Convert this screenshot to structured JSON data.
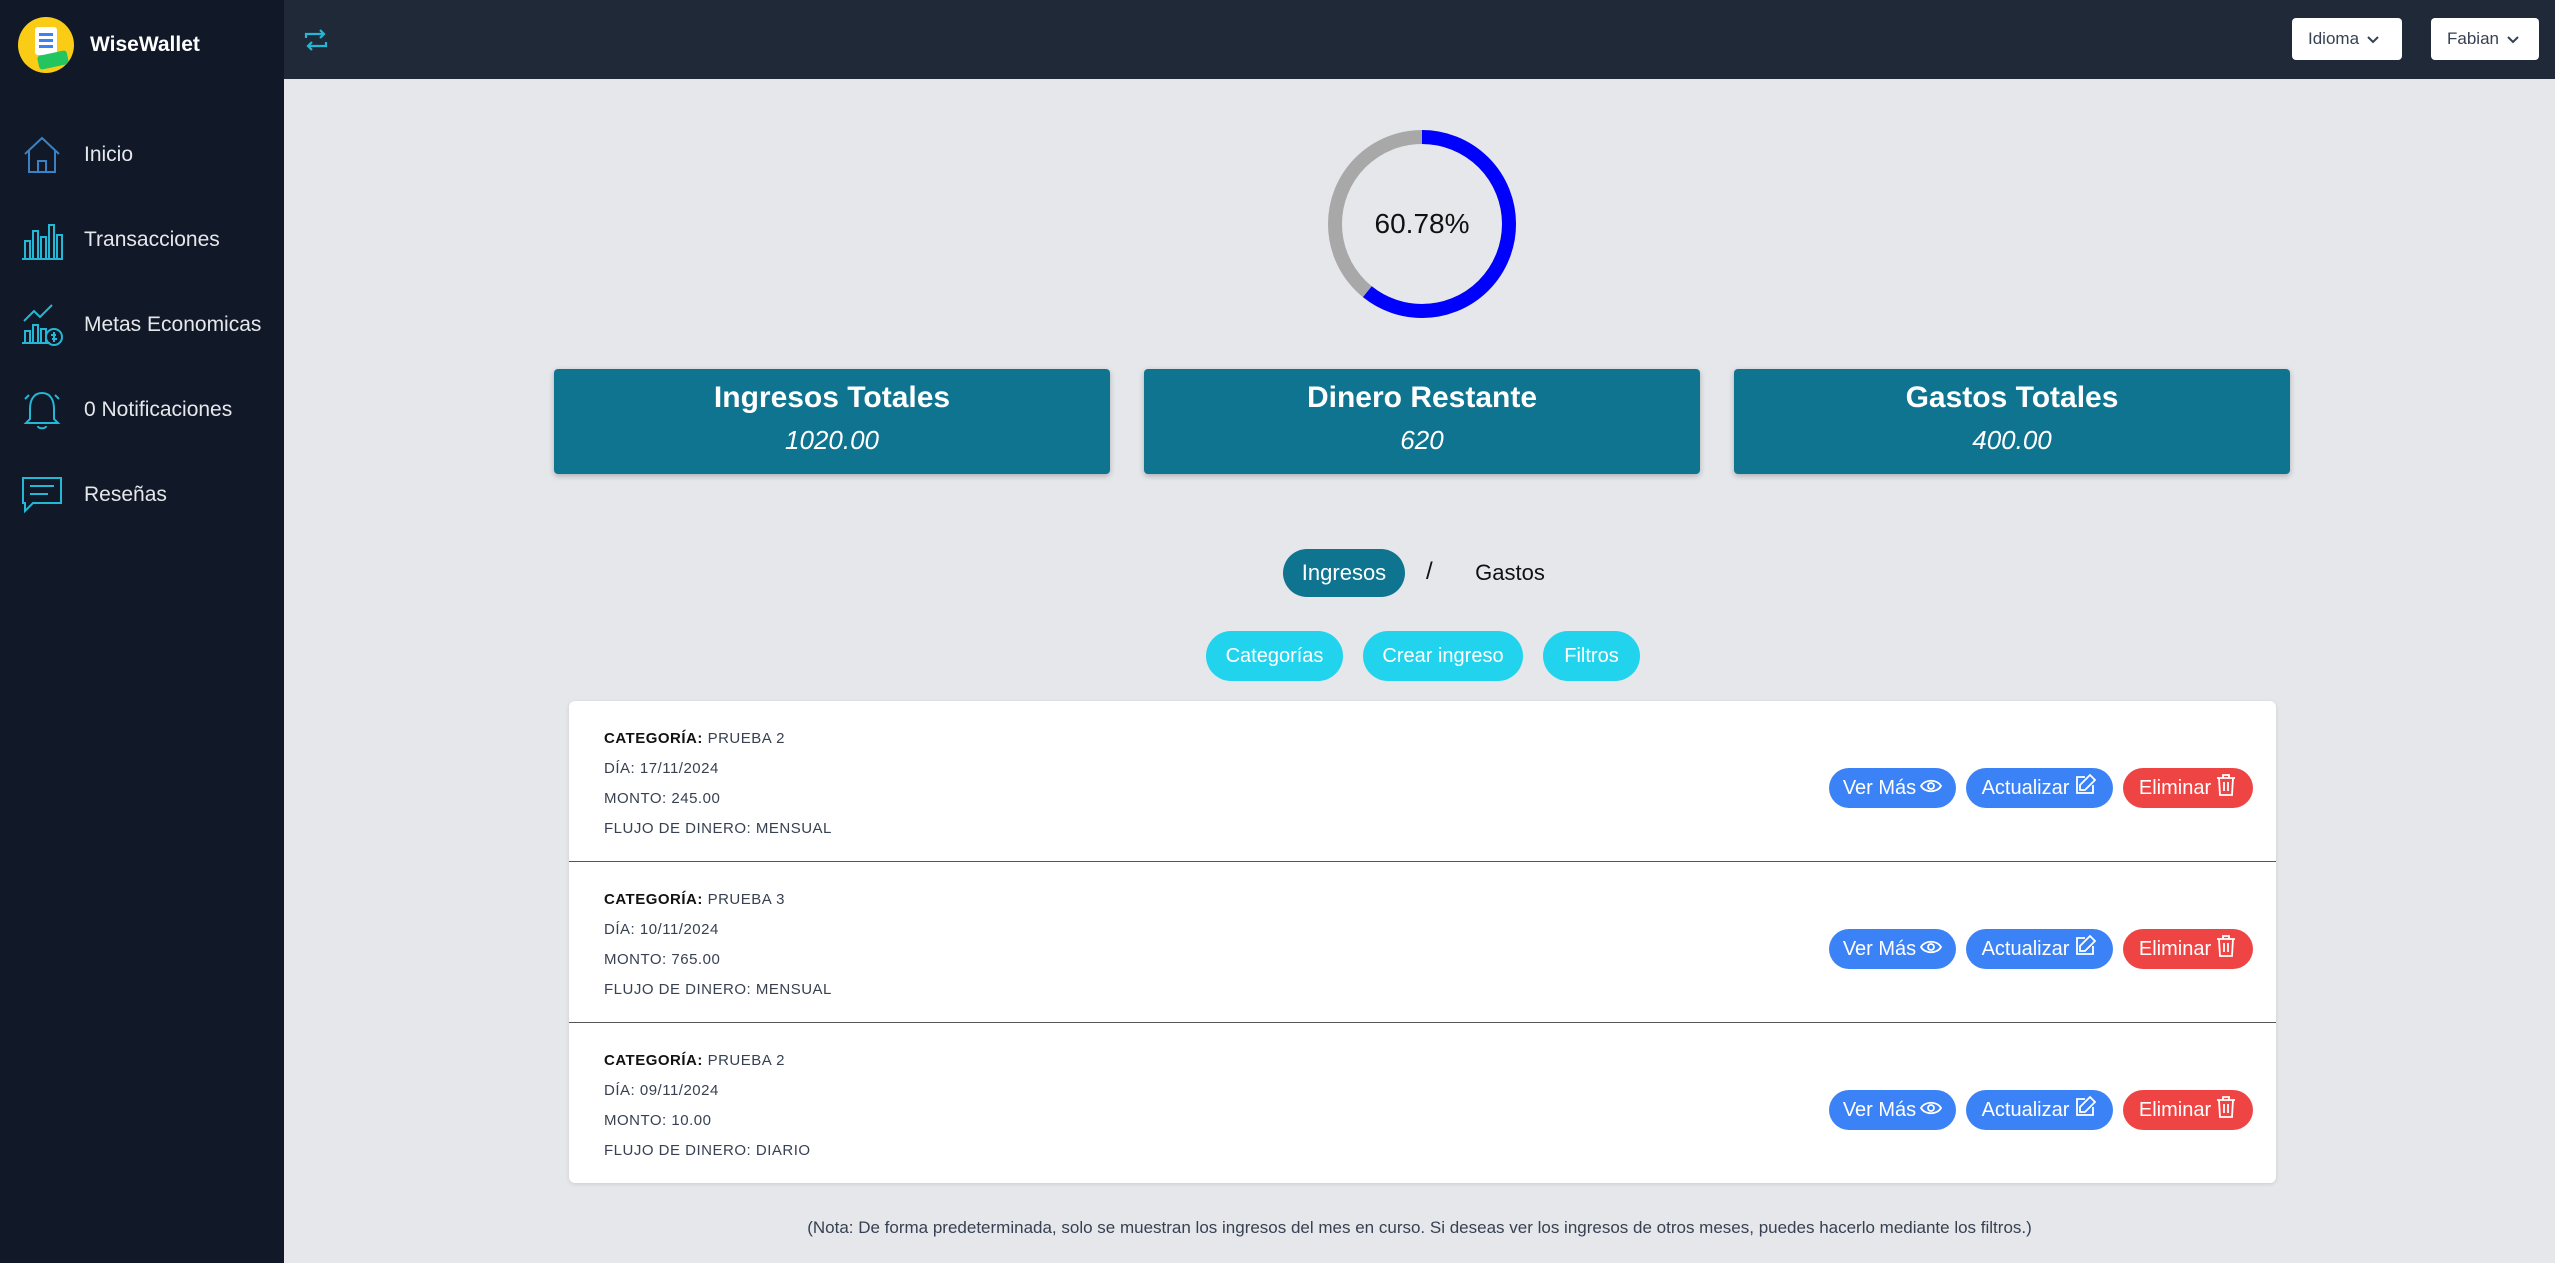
{
  "app": {
    "name": "WiseWallet"
  },
  "sidebar": {
    "items": [
      {
        "label": "Inicio",
        "icon": "home-icon"
      },
      {
        "label": "Transacciones",
        "icon": "bar-chart-icon"
      },
      {
        "label": "Metas Economicas",
        "icon": "money-goal-icon"
      },
      {
        "label": "0 Notificaciones",
        "icon": "bell-icon"
      },
      {
        "label": "Reseñas",
        "icon": "chat-icon"
      }
    ]
  },
  "topbar": {
    "language_label": "Idioma",
    "user_label": "Fabian"
  },
  "summary": {
    "percent_text": "60.78%",
    "percent_value": 60.78,
    "cards": [
      {
        "title": "Ingresos Totales",
        "value": "1020.00"
      },
      {
        "title": "Dinero Restante",
        "value": "620"
      },
      {
        "title": "Gastos Totales",
        "value": "400.00"
      }
    ]
  },
  "toggle": {
    "ingresos": "Ingresos",
    "separator": "/",
    "gastos": "Gastos"
  },
  "actions": {
    "categorias": "Categorías",
    "crear": "Crear ingreso",
    "filtros": "Filtros"
  },
  "field_labels": {
    "categoria": "CATEGORÍA:",
    "dia": "DÍA:",
    "monto": "MONTO:",
    "flujo": "FLUJO DE DINERO:"
  },
  "row_buttons": {
    "view": "Ver Más",
    "update": "Actualizar",
    "delete": "Eliminar"
  },
  "transactions": [
    {
      "categoria": "PRUEBA 2",
      "dia": "17/11/2024",
      "monto": "245.00",
      "flujo": "MENSUAL"
    },
    {
      "categoria": "PRUEBA 3",
      "dia": "10/11/2024",
      "monto": "765.00",
      "flujo": "MENSUAL"
    },
    {
      "categoria": "PRUEBA 2",
      "dia": "09/11/2024",
      "monto": "10.00",
      "flujo": "DIARIO"
    }
  ],
  "note": "(Nota: De forma predeterminada, solo se muestran los ingresos del mes en curso. Si deseas ver los ingresos de otros meses, puedes hacerlo mediante los filtros.)",
  "colors": {
    "sidebar": "#111827",
    "topbar": "#1f2937",
    "card": "#0e7490",
    "pill": "#22d3ee",
    "primary": "#3b82f6",
    "danger": "#ef4444",
    "donut_fill": "#0000ff",
    "donut_track": "#a8a8a8"
  }
}
